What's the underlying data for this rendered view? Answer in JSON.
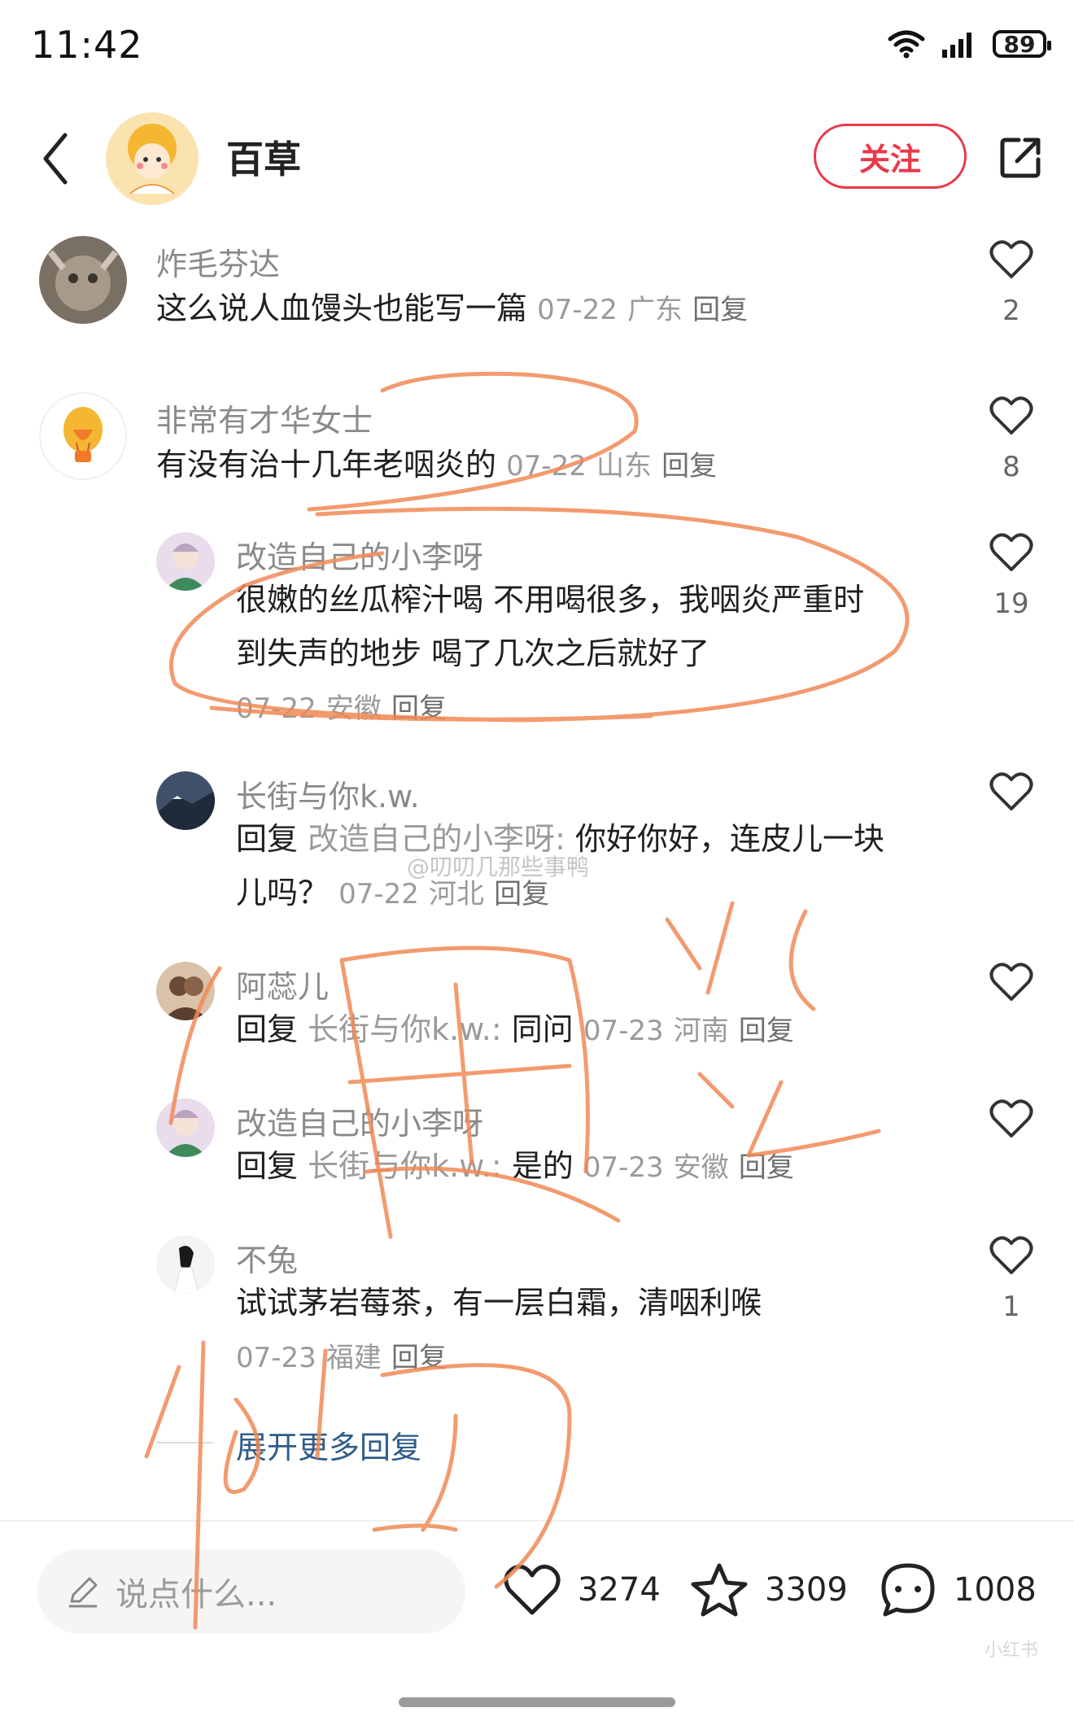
{
  "status_bar": {
    "time": "11:42",
    "battery": "89"
  },
  "nav": {
    "author_name": "百草",
    "follow_label": "关注"
  },
  "comments": [
    {
      "user": "炸毛芬达",
      "text": "这么说人血馒头也能写一篇",
      "date": "07-22",
      "location": "广东",
      "reply": "回复",
      "likes": "2"
    },
    {
      "user": "非常有才华女士",
      "text": "有没有治十几年老咽炎的",
      "date": "07-22",
      "location": "山东",
      "reply": "回复",
      "likes": "8"
    }
  ],
  "replies": [
    {
      "user": "改造自己的小李呀",
      "line1": "很嫩的丝瓜榨汁喝 不用喝很多，我咽炎严重时",
      "line2": "到失声的地步 喝了几次之后就好了",
      "date": "07-22",
      "location": "安徽",
      "reply": "回复",
      "likes": "19"
    },
    {
      "user": "长街与你k.w.",
      "prefix": "回复",
      "quoted": "改造自己的小李呀:",
      "line1_rest": " 你好你好，连皮儿一块",
      "line2": "儿吗？",
      "date": "07-22",
      "location": "河北",
      "reply": "回复",
      "likes": ""
    },
    {
      "user": "阿蕊儿",
      "prefix": "回复",
      "quoted": "长街与你k.w.:",
      "text": " 同问",
      "date": "07-23",
      "location": "河南",
      "reply": "回复",
      "likes": ""
    },
    {
      "user": "改造自己的小李呀",
      "prefix": "回复",
      "quoted": "长街与你k.w.:",
      "text": " 是的",
      "date": "07-23",
      "location": "安徽",
      "reply": "回复",
      "likes": ""
    },
    {
      "user": "不兔",
      "text": "试试茅岩莓茶，有一层白霜，清咽利喉",
      "date": "07-23",
      "location": "福建",
      "reply": "回复",
      "likes": "1"
    }
  ],
  "expand_label": "展开更多回复",
  "watermark": "@叨叨几那些事鸭",
  "corner_mark": "小红书",
  "bottom": {
    "placeholder": "说点什么...",
    "likes": "3274",
    "stars": "3309",
    "comments": "1008"
  },
  "icons": [
    "back-icon",
    "share-icon",
    "heart-icon",
    "star-icon",
    "comment-icon",
    "pen-icon",
    "wifi-icon",
    "signal-icon"
  ],
  "colors": {
    "accent": "#e8394a",
    "scribble": "#f08a57",
    "link": "#2f5d8a"
  }
}
